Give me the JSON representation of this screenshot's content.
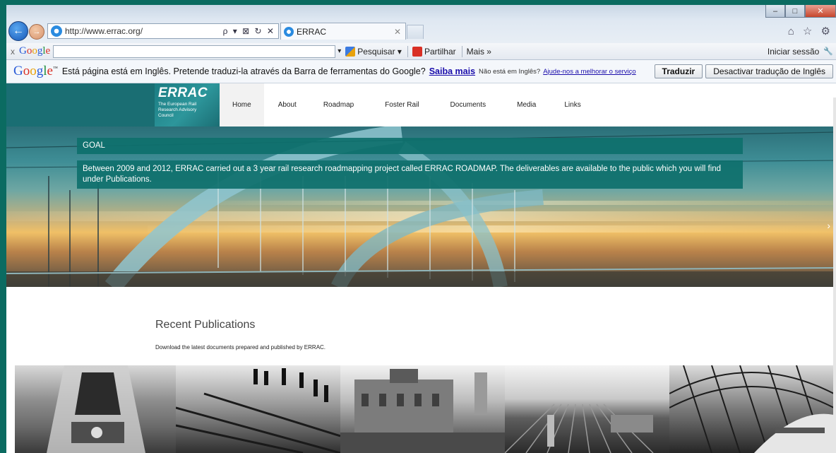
{
  "browser": {
    "address_url": "http://www.errac.org/",
    "address_controls": "ρ ▾ ⊠ ↻ ✕",
    "tab_title": "ERRAC",
    "tab_close": "✕",
    "window_controls": {
      "minimize": "–",
      "maximize": "□",
      "close": "✕"
    },
    "right_icons": "⌂ ☆ ⚙"
  },
  "google_toolbar": {
    "close": "x",
    "logo": "Google",
    "search_value": "",
    "dropdown": "▾",
    "pesquisar": "Pesquisar ▾",
    "partilhar": "Partilhar",
    "mais": "Mais »",
    "signin": "Iniciar sessão",
    "wrench": "🔧"
  },
  "translate_bar": {
    "logo": "Google",
    "logo_tm": "™",
    "message": "Está página está em Inglês.  Pretende traduzi-la através da Barra de ferramentas do Google?",
    "learn_more": "Saiba mais",
    "not_english": "Não está em Inglês?",
    "help_improve": "Ajude-nos a melhorar o serviço",
    "translate_btn": "Traduzir",
    "disable_btn": "Desactivar tradução de Inglês"
  },
  "site": {
    "logo": {
      "brand": "ERRAC",
      "line1": "The European Rail",
      "line2": "Research Advisory",
      "line3": "Council"
    },
    "menu": [
      "Home",
      "About",
      "Roadmap",
      "Foster Rail",
      "Documents",
      "Media",
      "Links"
    ],
    "hero": {
      "goal_label": "GOAL",
      "goal_text": "Between 2009 and 2012, ERRAC carried out a 3 year rail research roadmapping project called ERRAC ROADMAP. The deliverables are available to the public which you will find under Publications.",
      "next_arrow": "›"
    },
    "publications": {
      "title": "Recent Publications",
      "description": "Download the latest documents prepared and published by ERRAC."
    }
  },
  "colors": {
    "frame_teal": "#0b6b61",
    "nav_teal": "#1a6e73",
    "overlay_teal": "#0e706c"
  }
}
